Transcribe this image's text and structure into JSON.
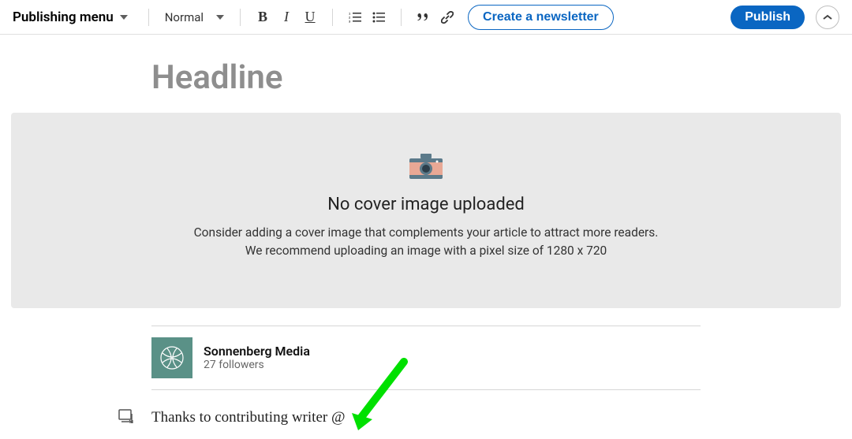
{
  "toolbar": {
    "publishing_menu": "Publishing menu",
    "text_style": "Normal",
    "create_newsletter": "Create a newsletter",
    "publish": "Publish"
  },
  "headline_placeholder": "Headline",
  "cover": {
    "title": "No cover image uploaded",
    "line1": "Consider adding a cover image that complements your article to attract more readers.",
    "line2": "We recommend uploading an image with a pixel size of 1280 x 720"
  },
  "author": {
    "name": "Sonnenberg Media",
    "followers": "27 followers"
  },
  "body_text": "Thanks to contributing writer @"
}
